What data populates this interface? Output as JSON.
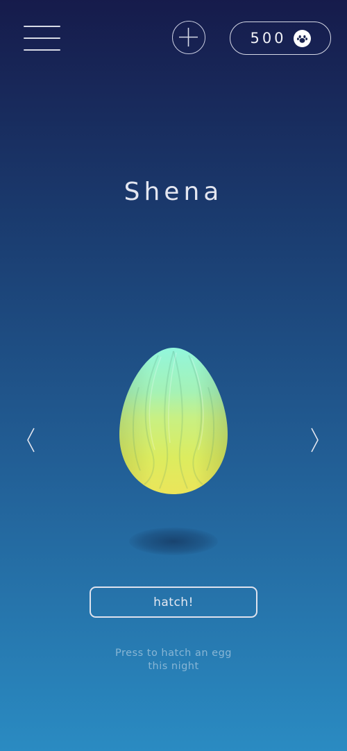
{
  "header": {
    "menu_icon": "hamburger-menu-icon",
    "add_icon": "plus-icon",
    "coins": {
      "value": "500",
      "icon": "paw-icon"
    }
  },
  "pet": {
    "name": "Shena",
    "egg_icon": "egg-icon"
  },
  "navigation": {
    "prev_icon": "chevron-left-icon",
    "next_icon": "chevron-right-icon"
  },
  "actions": {
    "hatch_label": "hatch!"
  },
  "hint": {
    "line1": "Press to hatch an egg",
    "line2": "this night"
  },
  "colors": {
    "background_top": "#161b4b",
    "background_bottom": "#2a8bc2",
    "egg_top": "#8ff5d2",
    "egg_bottom": "#e8ea57"
  }
}
